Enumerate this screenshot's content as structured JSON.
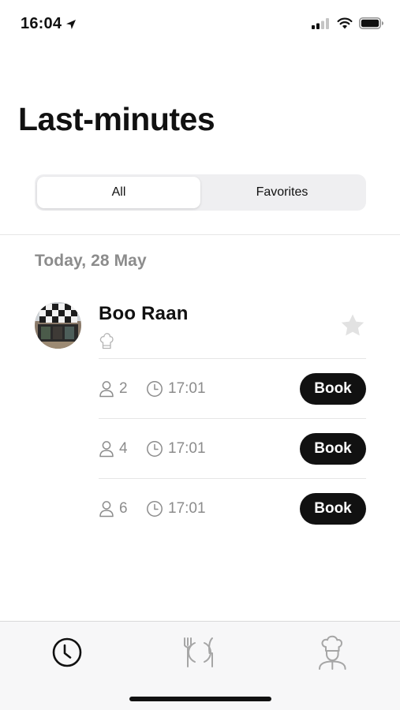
{
  "status_bar": {
    "time": "16:04",
    "icons": [
      "location-arrow-icon",
      "cellular-signal-icon",
      "wifi-icon",
      "battery-icon"
    ]
  },
  "page": {
    "title": "Last-minutes"
  },
  "segments": {
    "all_label": "All",
    "favorites_label": "Favorites",
    "selected": "All"
  },
  "sections": [
    {
      "day_label": "Today, 28 May",
      "restaurants": [
        {
          "name": "Boo Raan",
          "is_favorite": false,
          "slots": [
            {
              "guests": "2",
              "time": "17:01",
              "button_label": "Book"
            },
            {
              "guests": "4",
              "time": "17:01",
              "button_label": "Book"
            },
            {
              "guests": "6",
              "time": "17:01",
              "button_label": "Book"
            }
          ]
        }
      ]
    }
  ],
  "tab_bar": {
    "tabs": [
      {
        "icon": "clock-icon",
        "active": true
      },
      {
        "icon": "plate-cutlery-icon",
        "active": false
      },
      {
        "icon": "chef-icon",
        "active": false
      }
    ]
  },
  "colors": {
    "text_primary": "#111111",
    "text_secondary": "#8c8c8c",
    "button_bg": "#111111",
    "segment_bg": "#efeff1",
    "tab_inactive": "#a6a6a6",
    "star_inactive": "#e2e2e2"
  }
}
